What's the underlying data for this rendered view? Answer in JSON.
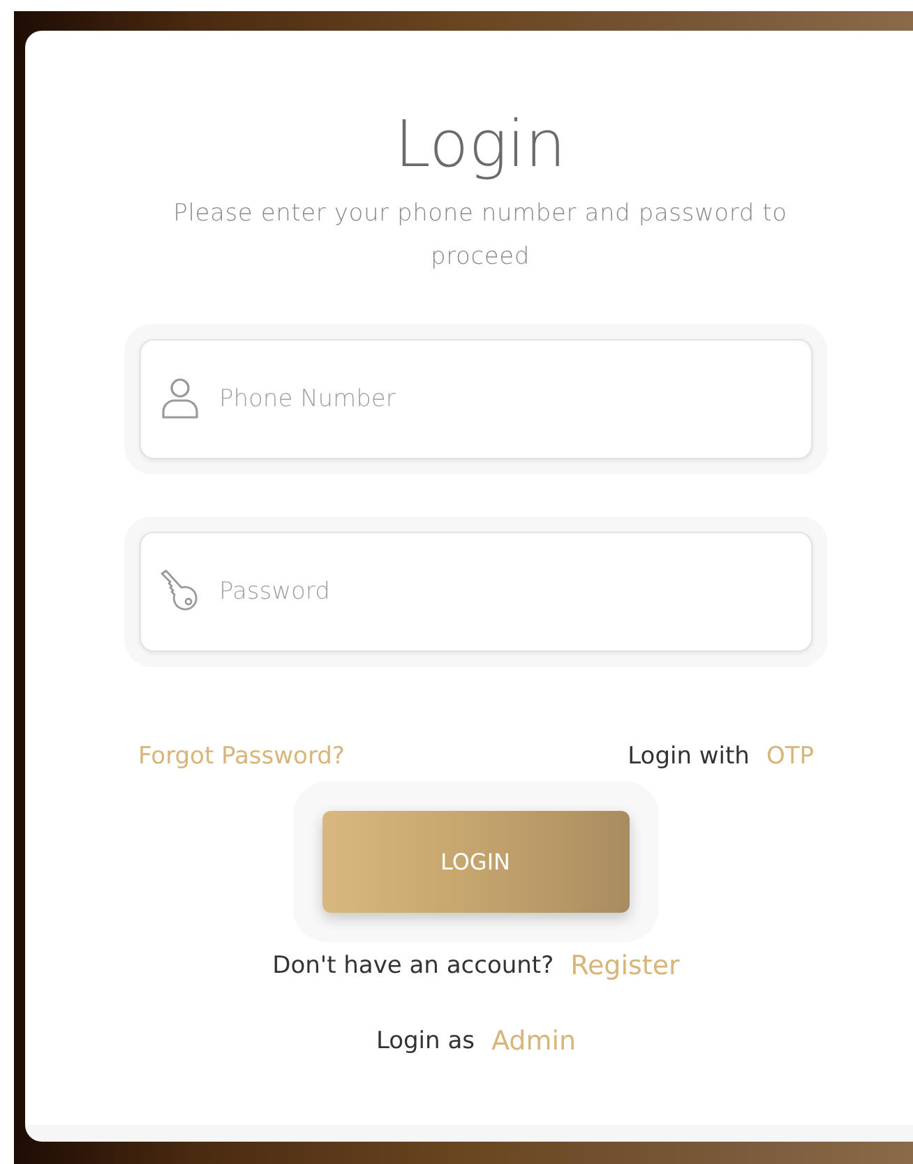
{
  "title": "Login",
  "subtitle": "Please enter your phone number and password to proceed",
  "fields": [
    {
      "kind": "phone",
      "placeholder": "Phone Number"
    },
    {
      "kind": "password",
      "placeholder": "Password"
    }
  ],
  "forgot_link": "Forgot Password?",
  "otp": {
    "text": "Login with",
    "link": "OTP"
  },
  "login_button": "LOGIN",
  "register": {
    "text": "Don't have an account?",
    "link": "Register"
  },
  "admin": {
    "text": "Login as",
    "link": "Admin"
  }
}
